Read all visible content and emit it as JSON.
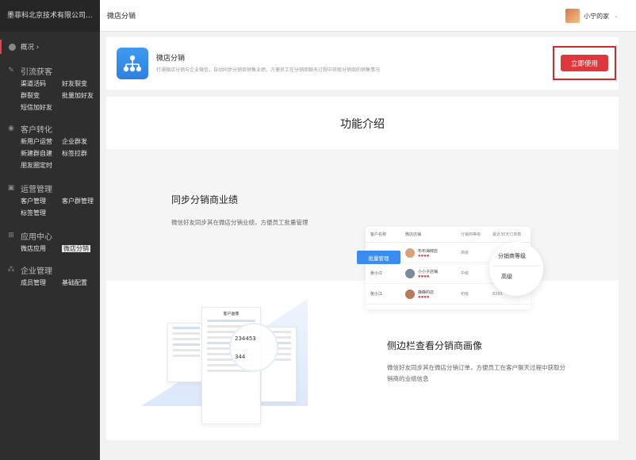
{
  "sidebar": {
    "company": "墨菲科北京技术有限公司...",
    "overview": "概况 ›",
    "groups": [
      {
        "title": "引流获客",
        "icon": "traffic-icon",
        "items": [
          "渠道活码",
          "好友裂变",
          "群裂变",
          "批量加好友",
          "短信加好友"
        ]
      },
      {
        "title": "客户转化",
        "icon": "conversion-icon",
        "items": [
          "新用户运营",
          "企业群发",
          "新建群自建",
          "标签拉群",
          "朋友圈定时"
        ]
      },
      {
        "title": "运营管理",
        "icon": "manage-icon",
        "items": [
          "客户管理",
          "客户群管理",
          "标签管理"
        ]
      },
      {
        "title": "应用中心",
        "icon": "apps-icon",
        "items": [
          "微店应用",
          "微店分销"
        ]
      },
      {
        "title": "企业管理",
        "icon": "org-icon",
        "items": [
          "成员管理",
          "基础配置"
        ]
      }
    ]
  },
  "header": {
    "title": "微店分销",
    "user": "小宁的家",
    "caret": "⌄"
  },
  "app": {
    "name": "微店分销",
    "desc": "打通微店分销与企业微信，自动同步分销商销售业绩，方便员工在分销商聊天过程中获取分销商的销售情况",
    "button": "立即使用"
  },
  "features": {
    "title": "功能介绍",
    "f1": {
      "heading": "同步分销商业绩",
      "desc": "微信好友同步其在微店分销业绩，方便员工批量管理"
    },
    "f2": {
      "heading": "侧边栏查看分销商画像",
      "desc": "微信好友同步其在微店分销订单，方便员工在客户聊天过程中获取分销商的业绩信息"
    }
  },
  "illustration": {
    "table_headers": [
      "客户名称",
      "微店店铺",
      "分销商等级",
      "最近30天订单数"
    ],
    "rows": [
      {
        "customer": "",
        "store": "布布海鲜店",
        "level": "高级"
      },
      {
        "customer": "张小江",
        "store": "小小子店铺",
        "level": "中级"
      },
      {
        "customer": "张小江",
        "store": "静静的店",
        "level": "初级",
        "orders": "8293"
      }
    ],
    "hearts": "♥♥♥♥",
    "batch_button": "批量管理",
    "circle_label": "分销商等级",
    "circle_value": "高级",
    "phone_title": "客户画像",
    "phone_values": [
      "234453",
      "344"
    ]
  }
}
